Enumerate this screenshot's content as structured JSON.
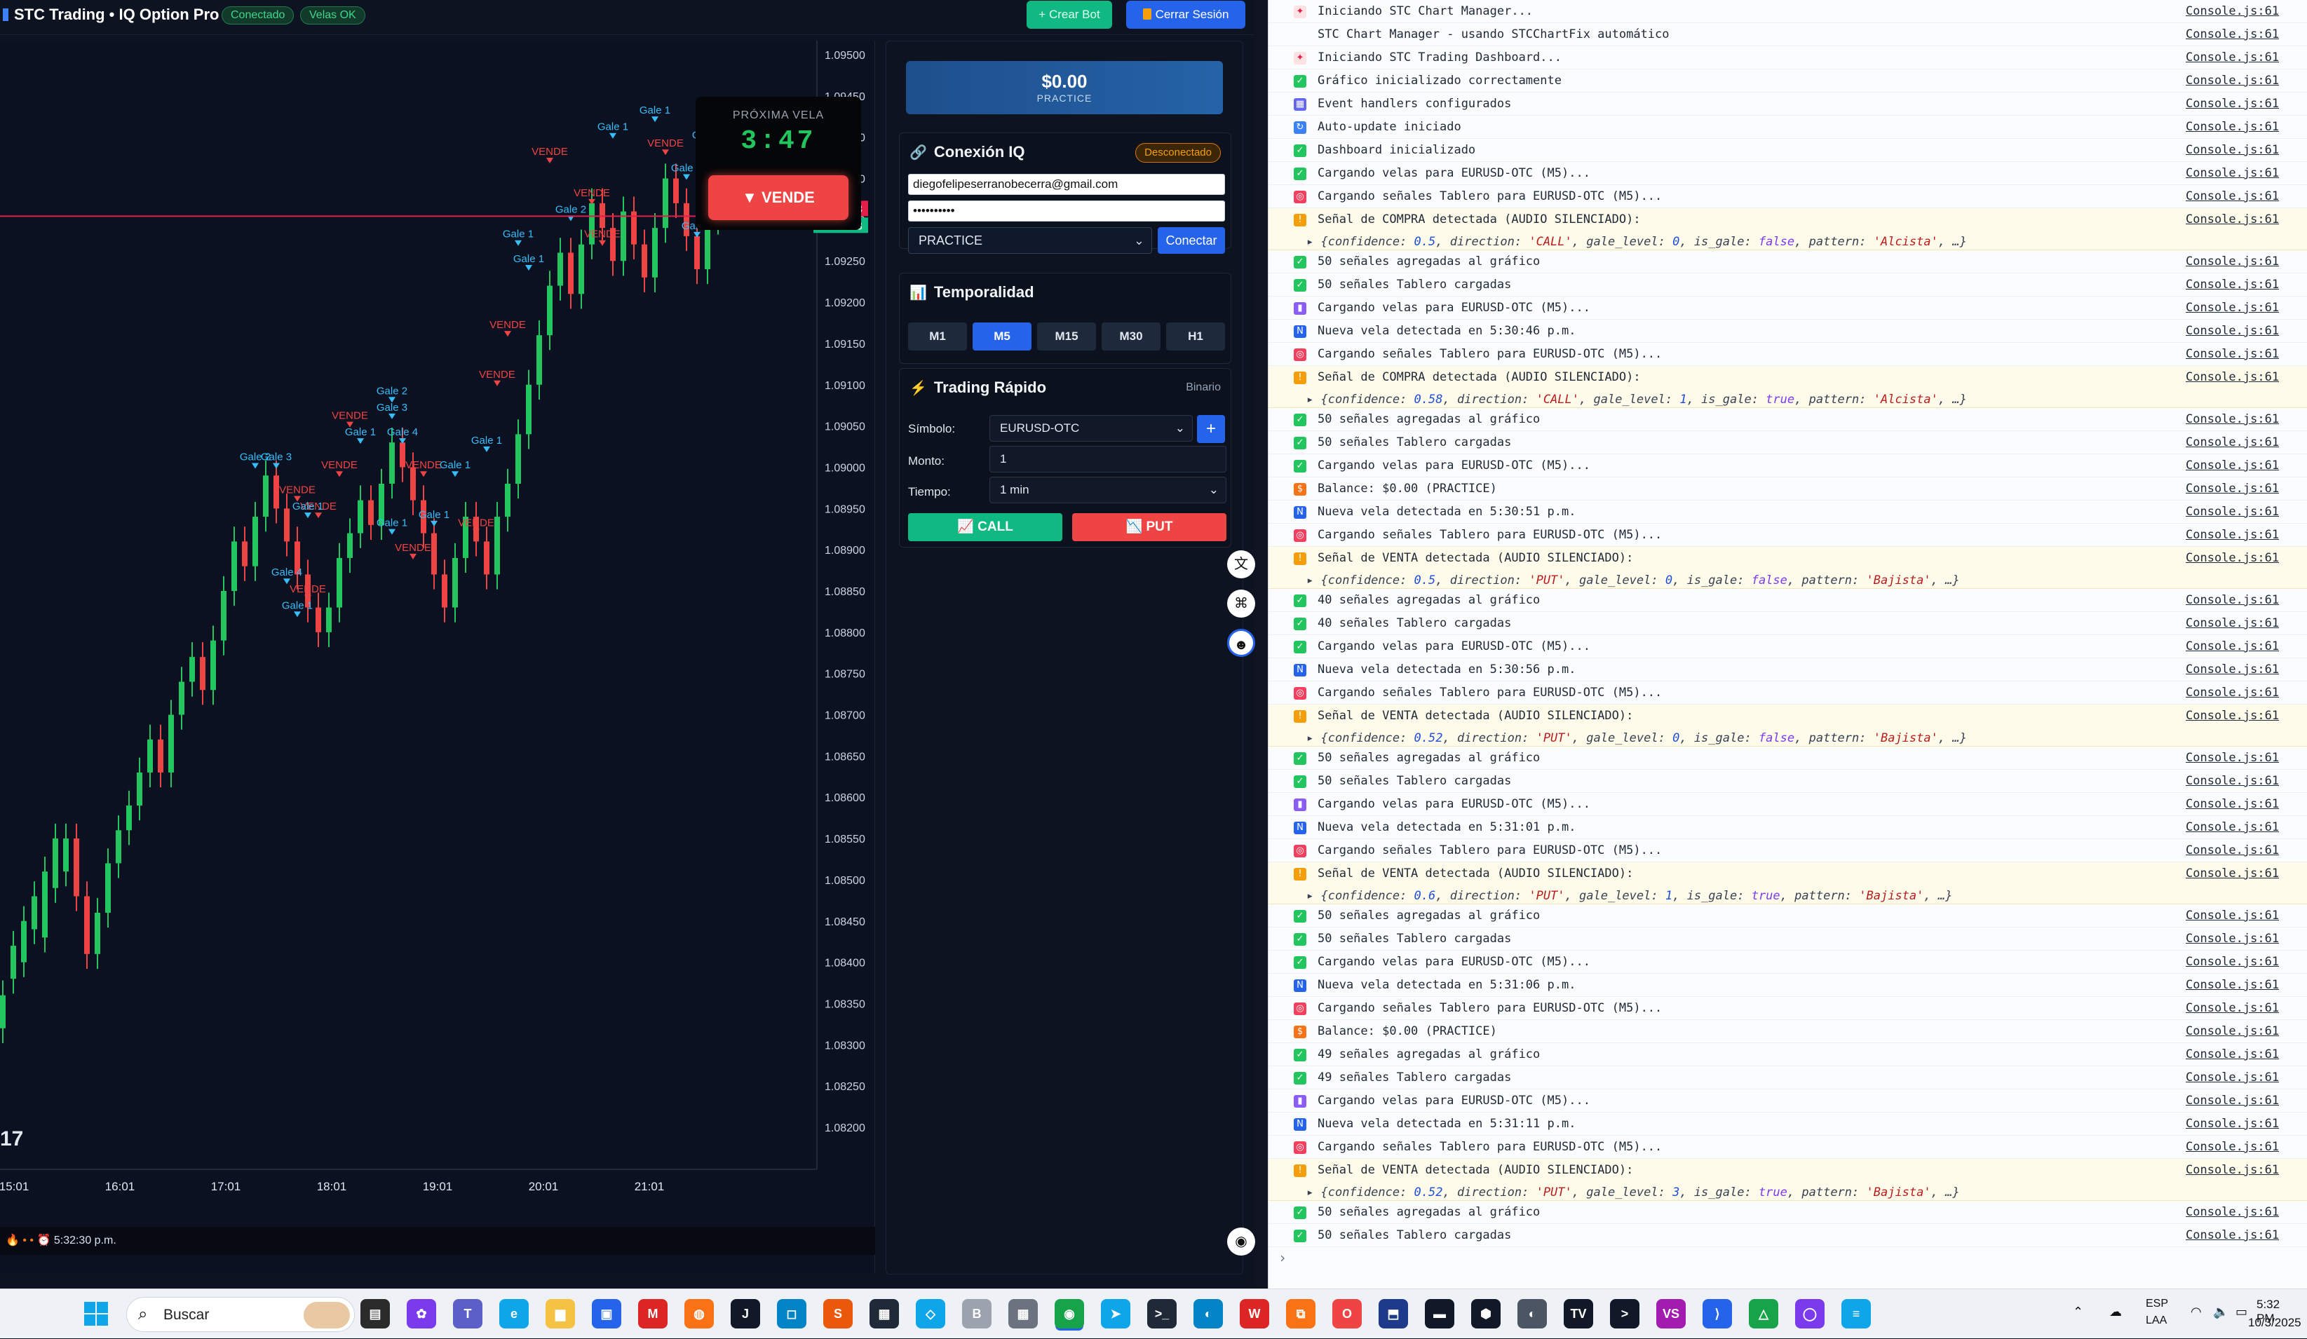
{
  "app": {
    "title": "STC Trading • IQ Option Pro",
    "status_connected": "Conectado",
    "status_candles": "Velas OK",
    "create_bot": "+ Crear Bot",
    "logout": "Cerrar Sesión"
  },
  "chart": {
    "next_candle_label": "PRÓXIMA VELA",
    "countdown": "3:47",
    "signal": "VENDE",
    "signal_arrow": "▼",
    "price_ticks": [
      "1.09500",
      "1.09450",
      "1.09400",
      "1.09350",
      "1.09300",
      "1.09250",
      "1.09200",
      "1.09150",
      "1.09100",
      "1.09050",
      "1.09000",
      "1.08950",
      "1.08900",
      "1.08850",
      "1.08800",
      "1.08750",
      "1.08700",
      "1.08650",
      "1.08600",
      "1.08550",
      "1.08500",
      "1.08450",
      "1.08400",
      "1.08350",
      "1.08300",
      "1.08250",
      "1.08200"
    ],
    "current_price": "1.09323",
    "time_ticks": [
      "15:01",
      "16:01",
      "17:01",
      "18:01",
      "19:01",
      "20:01",
      "21:01"
    ],
    "status_text": "5:32:30 p.m.",
    "status_icons": "🔥 • • ⏰",
    "tv_logo": "17"
  },
  "chart_data": {
    "type": "candlestick",
    "ylim": [
      1.082,
      1.095
    ],
    "current_price": 1.09323,
    "x": [
      "15:01",
      "16:01",
      "17:01",
      "18:01",
      "19:01",
      "20:01",
      "21:01"
    ],
    "candles": [
      [
        1.0832,
        1.0836
      ],
      [
        1.0838,
        1.0842
      ],
      [
        1.084,
        1.0845
      ],
      [
        1.0844,
        1.0848
      ],
      [
        1.0843,
        1.0851
      ],
      [
        1.0849,
        1.0855
      ],
      [
        1.0851,
        1.0855
      ],
      [
        1.0855,
        1.0848
      ],
      [
        1.0848,
        1.0841
      ],
      [
        1.0841,
        1.0846
      ],
      [
        1.0846,
        1.0852
      ],
      [
        1.0852,
        1.0856
      ],
      [
        1.0856,
        1.0859
      ],
      [
        1.0859,
        1.0863
      ],
      [
        1.0863,
        1.0867
      ],
      [
        1.0867,
        1.0863
      ],
      [
        1.0863,
        1.087
      ],
      [
        1.087,
        1.0874
      ],
      [
        1.0874,
        1.0877
      ],
      [
        1.0877,
        1.0873
      ],
      [
        1.0873,
        1.0879
      ],
      [
        1.0879,
        1.0885
      ],
      [
        1.0885,
        1.0891
      ],
      [
        1.0891,
        1.0888
      ],
      [
        1.0888,
        1.0894
      ],
      [
        1.0894,
        1.0899
      ],
      [
        1.0899,
        1.0895
      ],
      [
        1.0895,
        1.0891
      ],
      [
        1.0891,
        1.0887
      ],
      [
        1.0887,
        1.0883
      ],
      [
        1.0883,
        1.088
      ],
      [
        1.088,
        1.0883
      ],
      [
        1.0883,
        1.0889
      ],
      [
        1.0889,
        1.0892
      ],
      [
        1.0892,
        1.0896
      ],
      [
        1.0896,
        1.0893
      ],
      [
        1.0893,
        1.0898
      ],
      [
        1.0898,
        1.0903
      ],
      [
        1.0903,
        1.09
      ],
      [
        1.09,
        1.0896
      ],
      [
        1.0896,
        1.0892
      ],
      [
        1.0892,
        1.0887
      ],
      [
        1.0887,
        1.0883
      ],
      [
        1.0883,
        1.0889
      ],
      [
        1.0889,
        1.0894
      ],
      [
        1.0894,
        1.0891
      ],
      [
        1.0891,
        1.0887
      ],
      [
        1.0887,
        1.0894
      ],
      [
        1.0894,
        1.0898
      ],
      [
        1.0898,
        1.0904
      ],
      [
        1.0904,
        1.091
      ],
      [
        1.091,
        1.0916
      ],
      [
        1.0916,
        1.0922
      ],
      [
        1.0922,
        1.0926
      ],
      [
        1.0926,
        1.0921
      ],
      [
        1.0921,
        1.0927
      ],
      [
        1.0927,
        1.0932
      ],
      [
        1.0932,
        1.0929
      ],
      [
        1.0929,
        1.0925
      ],
      [
        1.0925,
        1.0931
      ],
      [
        1.0931,
        1.0927
      ],
      [
        1.0927,
        1.0923
      ],
      [
        1.0923,
        1.0929
      ],
      [
        1.0929,
        1.0935
      ],
      [
        1.0935,
        1.0932
      ],
      [
        1.0932,
        1.0928
      ],
      [
        1.0928,
        1.0924
      ],
      [
        1.0924,
        1.093
      ],
      [
        1.093,
        1.0932
      ]
    ],
    "signals": [
      {
        "label": "VENDE",
        "price": 1.0937,
        "i": 52
      },
      {
        "label": "Gale 1",
        "price": 1.094,
        "i": 58
      },
      {
        "label": "Gale 1",
        "price": 1.0942,
        "i": 62
      },
      {
        "label": "VENDE",
        "price": 1.0938,
        "i": 63
      },
      {
        "label": "Gale 3",
        "price": 1.0939,
        "i": 67
      },
      {
        "label": "Gale 1",
        "price": 1.0935,
        "i": 65
      },
      {
        "label": "VENDE",
        "price": 1.0932,
        "i": 56
      },
      {
        "label": "Gale 2",
        "price": 1.093,
        "i": 54
      },
      {
        "label": "VENDE",
        "price": 1.0927,
        "i": 57
      },
      {
        "label": "Gale 2",
        "price": 1.0928,
        "i": 66
      },
      {
        "label": "Gale 1",
        "price": 1.0927,
        "i": 49
      },
      {
        "label": "Gale 1",
        "price": 1.0924,
        "i": 50
      },
      {
        "label": "VENDE",
        "price": 1.0916,
        "i": 48
      },
      {
        "label": "VENDE",
        "price": 1.091,
        "i": 47
      },
      {
        "label": "Gale 2",
        "price": 1.0908,
        "i": 37
      },
      {
        "label": "Gale 3",
        "price": 1.0906,
        "i": 37
      },
      {
        "label": "VENDE",
        "price": 1.0905,
        "i": 33
      },
      {
        "label": "Gale 4",
        "price": 1.0903,
        "i": 38
      },
      {
        "label": "Gale 1",
        "price": 1.0903,
        "i": 34
      },
      {
        "label": "Gale 1",
        "price": 1.0902,
        "i": 46
      },
      {
        "label": "Gale 3",
        "price": 1.09,
        "i": 26
      },
      {
        "label": "Gale 2",
        "price": 1.09,
        "i": 24
      },
      {
        "label": "VENDE",
        "price": 1.0899,
        "i": 32
      },
      {
        "label": "VENDE",
        "price": 1.0899,
        "i": 40
      },
      {
        "label": "Gale 1",
        "price": 1.0899,
        "i": 43
      },
      {
        "label": "VENDE",
        "price": 1.0896,
        "i": 28
      },
      {
        "label": "VENDE",
        "price": 1.0894,
        "i": 30
      },
      {
        "label": "Gale 1",
        "price": 1.0893,
        "i": 41
      },
      {
        "label": "Gale 1",
        "price": 1.0894,
        "i": 29
      },
      {
        "label": "VENDE",
        "price": 1.0892,
        "i": 45
      },
      {
        "label": "Gale 1",
        "price": 1.0892,
        "i": 37
      },
      {
        "label": "VENDE",
        "price": 1.0889,
        "i": 39
      },
      {
        "label": "Gale 4",
        "price": 1.0886,
        "i": 27
      },
      {
        "label": "VENDE",
        "price": 1.0884,
        "i": 29
      },
      {
        "label": "Gale 1",
        "price": 1.0882,
        "i": 28
      }
    ]
  },
  "panel": {
    "balance": "$0.00",
    "balance_mode": "PRACTICE",
    "connection_title": "Conexión IQ",
    "connection_status": "Desconectado",
    "email_value": "diegofelipeserranobecerra@gmail.com",
    "password_value": "••••••••••",
    "account_type": "PRACTICE",
    "connect_button": "Conectar",
    "timeframe_title": "Temporalidad",
    "timeframes": [
      "M1",
      "M5",
      "M15",
      "M30",
      "H1"
    ],
    "timeframe_active": "M5",
    "quick_trade_title": "Trading Rápido",
    "quick_trade_type": "Binario",
    "symbol_label": "Símbolo:",
    "symbol_value": "EURUSD-OTC",
    "amount_label": "Monto:",
    "amount_value": "1",
    "time_label": "Tiempo:",
    "time_value": "1 min",
    "call_button": "CALL",
    "put_button": "PUT"
  },
  "console": {
    "source": "Console.js:61",
    "rows": [
      {
        "icon": "rocket",
        "text": "Iniciando STC Chart Manager..."
      },
      {
        "icon": "none",
        "text": "STC Chart Manager - usando STCChartFix automático"
      },
      {
        "icon": "rocket",
        "text": "Iniciando STC Trading Dashboard..."
      },
      {
        "icon": "check",
        "text": "Gráfico inicializado correctamente"
      },
      {
        "icon": "grid",
        "text": "Event handlers configurados"
      },
      {
        "icon": "refresh",
        "text": "Auto-update iniciado"
      },
      {
        "icon": "check",
        "text": "Dashboard inicializado"
      },
      {
        "icon": "check",
        "text": "Cargando velas para EURUSD-OTC (M5)..."
      },
      {
        "icon": "target",
        "text": "Cargando señales Tablero para EURUSD-OTC (M5)..."
      },
      {
        "icon": "warn",
        "text": "Señal de COMPRA detectada (AUDIO SILENCIADO):",
        "obj": {
          "confidence": "0.5",
          "direction": "'CALL'",
          "gale_level": "0",
          "is_gale": "false",
          "pattern": "'Alcista'"
        }
      },
      {
        "icon": "check",
        "text": "50 señales agregadas al gráfico"
      },
      {
        "icon": "check",
        "text": "50 señales Tablero cargadas"
      },
      {
        "icon": "chart",
        "text": "Cargando velas para EURUSD-OTC (M5)..."
      },
      {
        "icon": "new",
        "text": "Nueva vela detectada en 5:30:46 p.m."
      },
      {
        "icon": "target",
        "text": "Cargando señales Tablero para EURUSD-OTC (M5)..."
      },
      {
        "icon": "warn",
        "text": "Señal de COMPRA detectada (AUDIO SILENCIADO):",
        "obj": {
          "confidence": "0.58",
          "direction": "'CALL'",
          "gale_level": "1",
          "is_gale": "true",
          "pattern": "'Alcista'"
        }
      },
      {
        "icon": "check",
        "text": "50 señales agregadas al gráfico"
      },
      {
        "icon": "check",
        "text": "50 señales Tablero cargadas"
      },
      {
        "icon": "check",
        "text": "Cargando velas para EURUSD-OTC (M5)..."
      },
      {
        "icon": "money",
        "text": "Balance: $0.00 (PRACTICE)"
      },
      {
        "icon": "new",
        "text": "Nueva vela detectada en 5:30:51 p.m."
      },
      {
        "icon": "target",
        "text": "Cargando señales Tablero para EURUSD-OTC (M5)..."
      },
      {
        "icon": "warn",
        "text": "Señal de VENTA detectada (AUDIO SILENCIADO):",
        "obj": {
          "confidence": "0.5",
          "direction": "'PUT'",
          "gale_level": "0",
          "is_gale": "false",
          "pattern": "'Bajista'"
        }
      },
      {
        "icon": "check",
        "text": "40 señales agregadas al gráfico"
      },
      {
        "icon": "check",
        "text": "40 señales Tablero cargadas"
      },
      {
        "icon": "check",
        "text": "Cargando velas para EURUSD-OTC (M5)..."
      },
      {
        "icon": "new",
        "text": "Nueva vela detectada en 5:30:56 p.m."
      },
      {
        "icon": "target",
        "text": "Cargando señales Tablero para EURUSD-OTC (M5)..."
      },
      {
        "icon": "warn",
        "text": "Señal de VENTA detectada (AUDIO SILENCIADO):",
        "obj": {
          "confidence": "0.52",
          "direction": "'PUT'",
          "gale_level": "0",
          "is_gale": "false",
          "pattern": "'Bajista'"
        }
      },
      {
        "icon": "check",
        "text": "50 señales agregadas al gráfico"
      },
      {
        "icon": "check",
        "text": "50 señales Tablero cargadas"
      },
      {
        "icon": "chart",
        "text": "Cargando velas para EURUSD-OTC (M5)..."
      },
      {
        "icon": "new",
        "text": "Nueva vela detectada en 5:31:01 p.m."
      },
      {
        "icon": "target",
        "text": "Cargando señales Tablero para EURUSD-OTC (M5)..."
      },
      {
        "icon": "warn",
        "text": "Señal de VENTA detectada (AUDIO SILENCIADO):",
        "obj": {
          "confidence": "0.6",
          "direction": "'PUT'",
          "gale_level": "1",
          "is_gale": "true",
          "pattern": "'Bajista'"
        }
      },
      {
        "icon": "check",
        "text": "50 señales agregadas al gráfico"
      },
      {
        "icon": "check",
        "text": "50 señales Tablero cargadas"
      },
      {
        "icon": "check",
        "text": "Cargando velas para EURUSD-OTC (M5)..."
      },
      {
        "icon": "new",
        "text": "Nueva vela detectada en 5:31:06 p.m."
      },
      {
        "icon": "target",
        "text": "Cargando señales Tablero para EURUSD-OTC (M5)..."
      },
      {
        "icon": "money",
        "text": "Balance: $0.00 (PRACTICE)"
      },
      {
        "icon": "check",
        "text": "49 señales agregadas al gráfico"
      },
      {
        "icon": "check",
        "text": "49 señales Tablero cargadas"
      },
      {
        "icon": "chart",
        "text": "Cargando velas para EURUSD-OTC (M5)..."
      },
      {
        "icon": "new",
        "text": "Nueva vela detectada en 5:31:11 p.m."
      },
      {
        "icon": "target",
        "text": "Cargando señales Tablero para EURUSD-OTC (M5)..."
      },
      {
        "icon": "warn",
        "text": "Señal de VENTA detectada (AUDIO SILENCIADO):",
        "obj": {
          "confidence": "0.52",
          "direction": "'PUT'",
          "gale_level": "3",
          "is_gale": "true",
          "pattern": "'Bajista'"
        }
      },
      {
        "icon": "check",
        "text": "50 señales agregadas al gráfico"
      },
      {
        "icon": "check",
        "text": "50 señales Tablero cargadas"
      }
    ],
    "prompt": "›"
  },
  "taskbar": {
    "search_placeholder": "Buscar",
    "lang": "ESP",
    "lang2": "LAA",
    "time": "5:32 PM",
    "date": "10/3/2025"
  },
  "colors": {
    "bull": "#22c55e",
    "bear": "#ef4444",
    "signal_sell": "#ef4444",
    "gale": "#38bdf8",
    "accent": "#2563eb"
  }
}
